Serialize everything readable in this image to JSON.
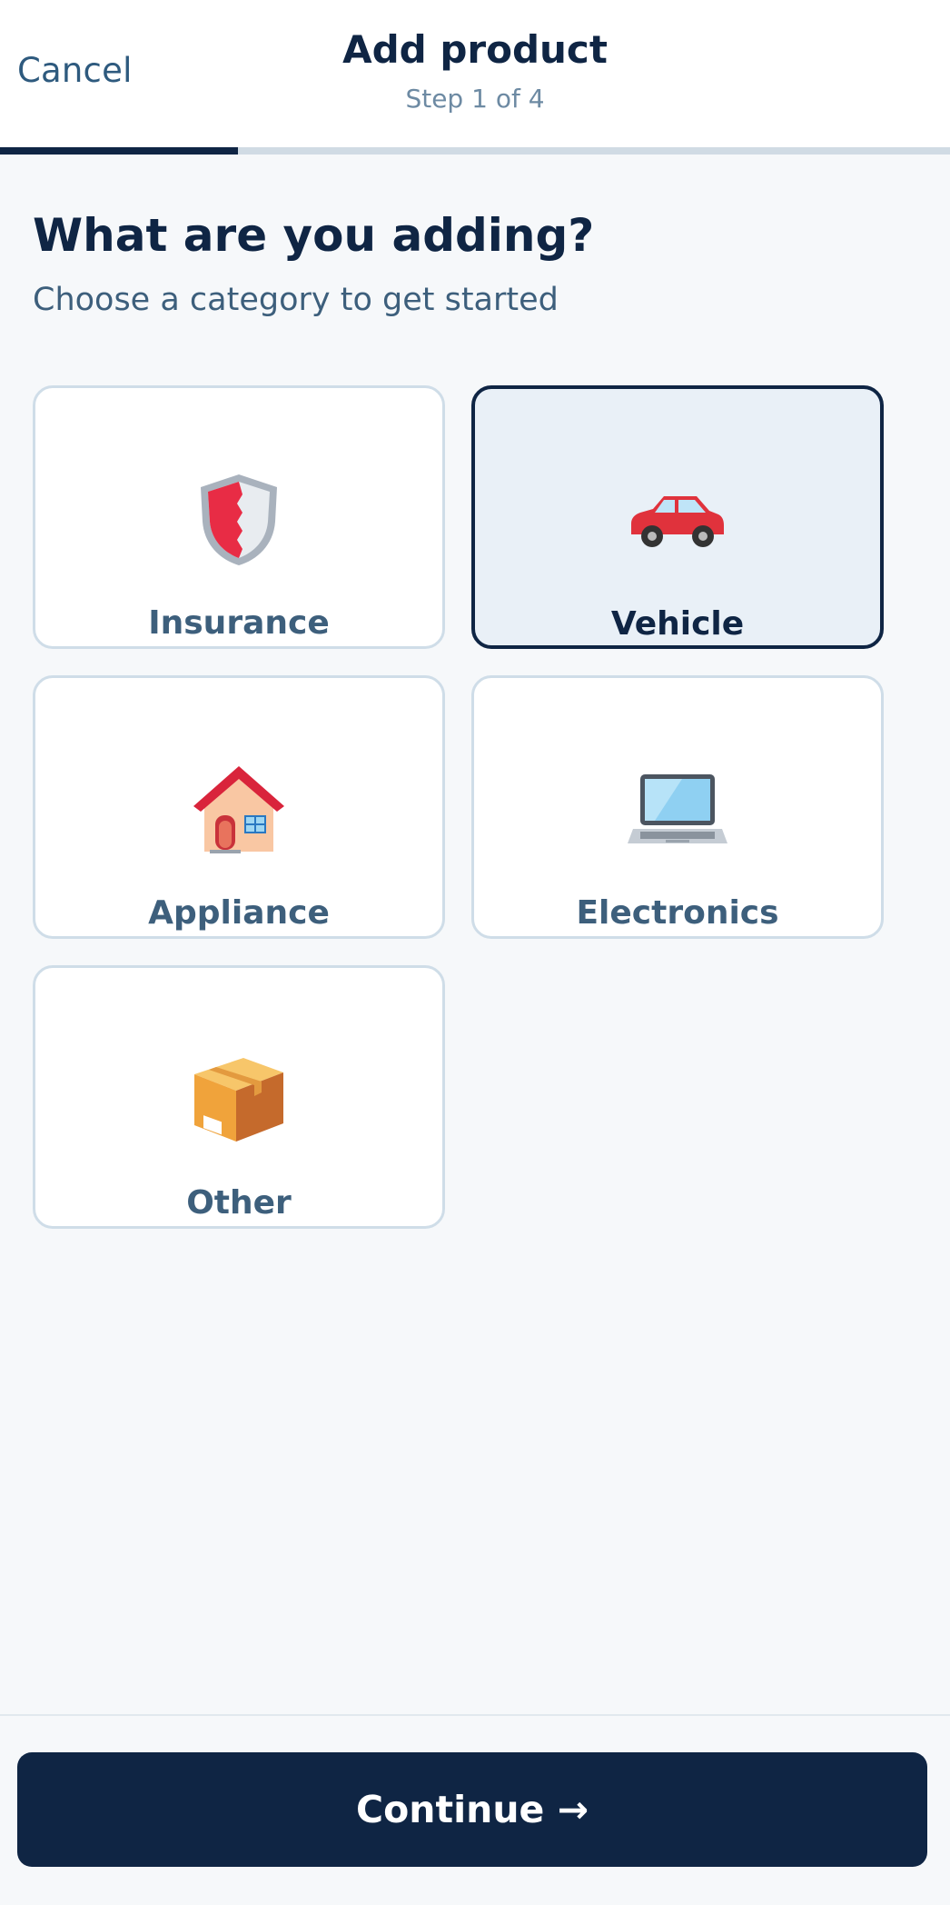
{
  "header": {
    "cancel_label": "Cancel",
    "title": "Add product",
    "step_text": "Step 1 of 4"
  },
  "progress": {
    "current_step": 1,
    "total_steps": 4
  },
  "main": {
    "heading": "What are you adding?",
    "subheading": "Choose a category to get started"
  },
  "categories": [
    {
      "label": "Insurance",
      "icon": "shield-icon",
      "selected": false
    },
    {
      "label": "Vehicle",
      "icon": "car-icon",
      "selected": true
    },
    {
      "label": "Appliance",
      "icon": "house-icon",
      "selected": false
    },
    {
      "label": "Electronics",
      "icon": "laptop-icon",
      "selected": false
    },
    {
      "label": "Other",
      "icon": "package-icon",
      "selected": false
    }
  ],
  "footer": {
    "continue_label": "Continue →"
  },
  "colors": {
    "primary": "#0f2544",
    "selected_bg": "#e9f0f7",
    "card_border": "#cfdde8",
    "page_bg": "#f6f8fa"
  }
}
